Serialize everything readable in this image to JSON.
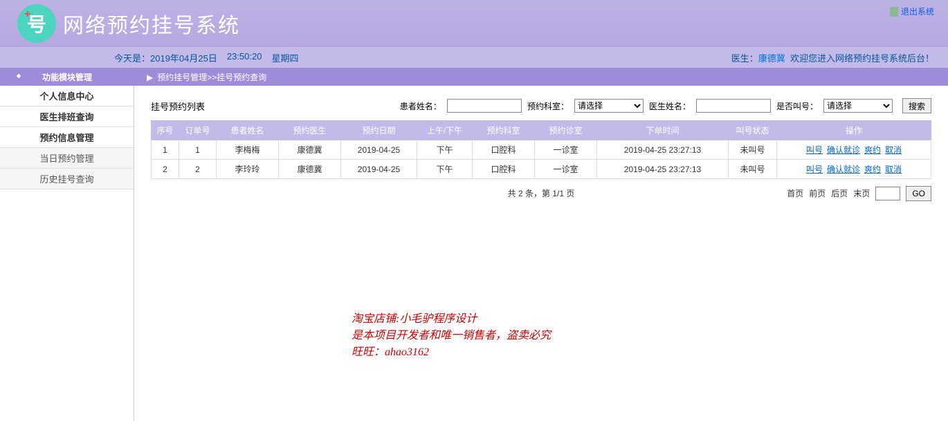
{
  "header": {
    "logo_char": "号",
    "logo_plus": "+",
    "title": "网络预约挂号系统",
    "exit": "退出系统"
  },
  "info_bar": {
    "today_prefix": "今天是：",
    "today_date": "2019年04月25日",
    "today_time": "23:50:20",
    "today_weekday": "星期四",
    "doctor_label": "医生：",
    "doctor_name": "康德冀",
    "welcome": "欢迎您进入网络预约挂号系统后台！"
  },
  "breadcrumb": {
    "section": "功能模块管理",
    "arrow": "▶",
    "path": "预约挂号管理>>挂号预约查询"
  },
  "sidebar": {
    "items": [
      {
        "label": "个人信息中心",
        "sub": false
      },
      {
        "label": "医生排班查询",
        "sub": false
      },
      {
        "label": "预约信息管理",
        "sub": false
      },
      {
        "label": "当日预约管理",
        "sub": true
      },
      {
        "label": "历史挂号查询",
        "sub": true
      }
    ]
  },
  "filters": {
    "list_title": "挂号预约列表",
    "patient_label": "患者姓名：",
    "dept_label": "预约科室：",
    "dept_placeholder": "请选择",
    "doctor_label": "医生姓名：",
    "called_label": "是否叫号：",
    "called_placeholder": "请选择",
    "search_btn": "搜索"
  },
  "table": {
    "headers": [
      "序号",
      "订单号",
      "患者姓名",
      "预约医生",
      "预约日期",
      "上午/下午",
      "预约科室",
      "预约诊室",
      "下单时间",
      "叫号状态",
      "操作"
    ],
    "rows": [
      {
        "seq": "1",
        "order": "1",
        "patient": "李梅梅",
        "doctor": "康德冀",
        "date": "2019-04-25",
        "ampm": "下午",
        "dept": "口腔科",
        "room": "一诊室",
        "time": "2019-04-25 23:27:13",
        "status": "未叫号"
      },
      {
        "seq": "2",
        "order": "2",
        "patient": "李玲玲",
        "doctor": "康德冀",
        "date": "2019-04-25",
        "ampm": "下午",
        "dept": "口腔科",
        "room": "一诊室",
        "time": "2019-04-25 23:27:13",
        "status": "未叫号"
      }
    ],
    "actions": [
      "叫号",
      "确认就诊",
      "爽约",
      "取消"
    ]
  },
  "pagination": {
    "summary": "共 2 条，第 1/1 页",
    "first": "首页",
    "prev": "前页",
    "next": "后页",
    "last": "末页",
    "go": "GO"
  },
  "watermark": {
    "line1": "淘宝店铺:小毛驴程序设计",
    "line2": "是本项目开发者和唯一销售者，盗卖必究",
    "line3": "旺旺：ahao3162"
  }
}
